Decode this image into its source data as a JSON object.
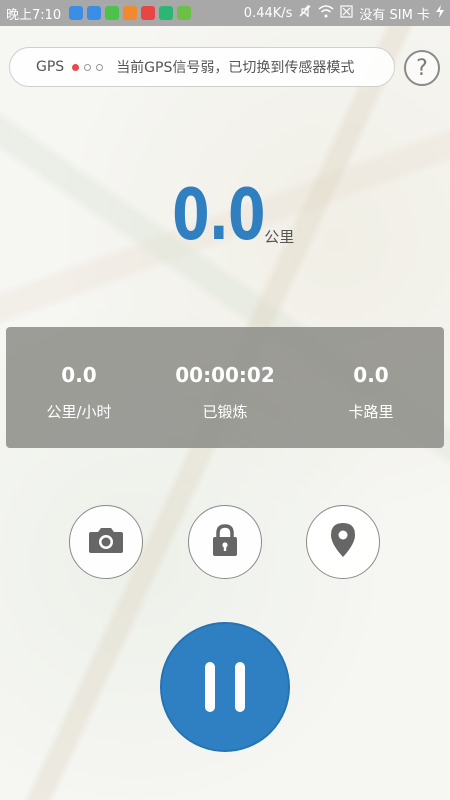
{
  "status_bar": {
    "time": "晚上7:10",
    "speed": "0.44K/s",
    "sim": "没有 SIM 卡",
    "app_icon_colors": [
      "#3a8ee6",
      "#3a8ee6",
      "#4cc24c",
      "#f08a2c",
      "#e84545",
      "#2bb673",
      "#6cc04a"
    ]
  },
  "gps": {
    "label": "GPS",
    "message": "当前GPS信号弱，已切换到传感器模式"
  },
  "help": {
    "label": "?"
  },
  "distance": {
    "value": "0.0",
    "unit": "公里"
  },
  "stats": [
    {
      "value": "0.0",
      "label": "公里/小时"
    },
    {
      "value": "00:00:02",
      "label": "已锻炼"
    },
    {
      "value": "0.0",
      "label": "卡路里"
    }
  ],
  "actions": {
    "camera_icon": "camera-icon",
    "lock_icon": "lock-icon",
    "location_icon": "location-pin-icon",
    "pause_icon": "pause-icon"
  },
  "colors": {
    "accent": "#2f80c3",
    "gps_dot_active": "#e64a4a",
    "panel": "#8c8c87"
  }
}
